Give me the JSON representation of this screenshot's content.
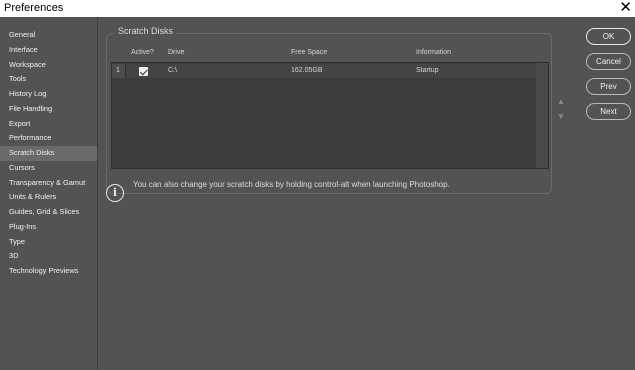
{
  "window": {
    "title": "Preferences",
    "close_glyph": "✕"
  },
  "sidebar": {
    "items": [
      {
        "label": "General"
      },
      {
        "label": "Interface"
      },
      {
        "label": "Workspace"
      },
      {
        "label": "Tools"
      },
      {
        "label": "History Log"
      },
      {
        "label": "File Handling"
      },
      {
        "label": "Export"
      },
      {
        "label": "Performance"
      },
      {
        "label": "Scratch Disks",
        "selected": true
      },
      {
        "label": "Cursors"
      },
      {
        "label": "Transparency & Gamut"
      },
      {
        "label": "Units & Rulers"
      },
      {
        "label": "Guides, Grid & Slices"
      },
      {
        "label": "Plug-Ins"
      },
      {
        "label": "Type"
      },
      {
        "label": "3D"
      },
      {
        "label": "Technology Previews"
      }
    ]
  },
  "scratch_disks": {
    "title": "Scratch Disks",
    "columns": {
      "active": "Active?",
      "drive": "Drive",
      "free_space": "Free Space",
      "information": "Information"
    },
    "rows": [
      {
        "index": "1",
        "active": true,
        "drive": "C:\\",
        "free_space": "162.05GB",
        "information": "Startup"
      }
    ],
    "move_up_glyph": "▲",
    "move_down_glyph": "▼"
  },
  "info": {
    "icon": "info-icon",
    "text": "You can also change your scratch disks by holding control-alt when launching Photoshop."
  },
  "buttons": {
    "ok": "OK",
    "cancel": "Cancel",
    "prev": "Prev",
    "next": "Next"
  },
  "colors": {
    "background": "#535353",
    "panel": "#3c3c3c",
    "selected": "#6a6a6a"
  }
}
